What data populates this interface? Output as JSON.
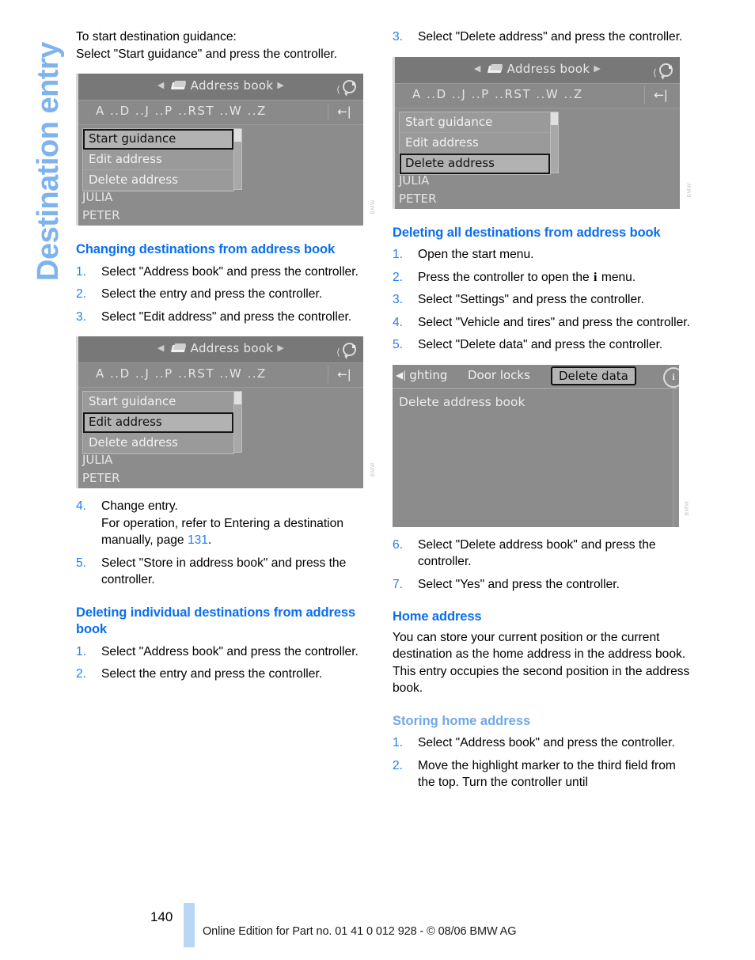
{
  "chapter_tab": "Destination entry",
  "left_column": {
    "intro": {
      "line1": "To start destination guidance:",
      "line2": "Select \"Start guidance\" and press the controller."
    },
    "figure1": {
      "title": "Address book",
      "icon": "address-book-icon",
      "alpha_bar": "A ..D ..J ..P ..RST ..W ..Z",
      "back_icon": "back-arrow-icon",
      "compass_icon": "compass-icon",
      "menu_items": [
        "Start guidance",
        "Edit address",
        "Delete address"
      ],
      "selected_item": "Start guidance",
      "entries": [
        "JULIA",
        "PETER"
      ]
    },
    "section1": {
      "heading": "Changing destinations from address book",
      "steps": [
        {
          "num": "1.",
          "text": "Select \"Address book\" and press the controller."
        },
        {
          "num": "2.",
          "text": "Select the entry and press the controller."
        },
        {
          "num": "3.",
          "text": "Select \"Edit address\" and press the controller."
        }
      ]
    },
    "figure2": {
      "title": "Address book",
      "icon": "address-book-icon",
      "alpha_bar": "A ..D ..J ..P ..RST ..W ..Z",
      "back_icon": "back-arrow-icon",
      "compass_icon": "compass-icon",
      "menu_items": [
        "Start guidance",
        "Edit address",
        "Delete address"
      ],
      "selected_item": "Edit address",
      "entries": [
        "JULIA",
        "PETER"
      ]
    },
    "steps_after_fig2": [
      {
        "num": "4.",
        "text_a": "Change entry.",
        "text_b": "For operation, refer to Entering a destination manually, page ",
        "pageref": "131",
        "text_c": "."
      },
      {
        "num": "5.",
        "text": "Select \"Store in address book\" and press the controller."
      }
    ],
    "section2": {
      "heading": "Deleting individual destinations from address book",
      "steps": [
        {
          "num": "1.",
          "text": "Select \"Address book\" and press the controller."
        },
        {
          "num": "2.",
          "text": "Select the entry and press the controller."
        }
      ]
    }
  },
  "right_column": {
    "step3": {
      "num": "3.",
      "text": "Select \"Delete address\" and press the controller."
    },
    "figure3": {
      "title": "Address book",
      "icon": "address-book-icon",
      "alpha_bar": "A ..D ..J ..P ..RST ..W ..Z",
      "back_icon": "back-arrow-icon",
      "compass_icon": "compass-icon",
      "menu_items": [
        "Start guidance",
        "Edit address",
        "Delete address"
      ],
      "selected_item": "Delete address",
      "entries": [
        "JULIA",
        "PETER"
      ]
    },
    "section3": {
      "heading": "Deleting all destinations from address book",
      "steps": [
        {
          "num": "1.",
          "text": "Open the start menu."
        },
        {
          "num": "2.",
          "text_a": "Press the controller to open the ",
          "iglyph": "i",
          "text_b": " menu."
        },
        {
          "num": "3.",
          "text": "Select \"Settings\" and press the controller."
        },
        {
          "num": "4.",
          "text": "Select \"Vehicle and tires\" and press the controller."
        },
        {
          "num": "5.",
          "text": "Select \"Delete data\" and press the controller."
        }
      ]
    },
    "figure4": {
      "tab_left": "ghting",
      "tab_left_icon": "scroll-left-icon",
      "tab_middle": "Door locks",
      "tab_selected": "Delete data",
      "info_icon": "info-icon",
      "list_item": "Delete address book"
    },
    "steps_after_fig4": [
      {
        "num": "6.",
        "text": "Select \"Delete address book\" and press the controller."
      },
      {
        "num": "7.",
        "text": "Select \"Yes\" and press the controller."
      }
    ],
    "section4": {
      "heading": "Home address",
      "paragraph": "You can store your current position or the current destination as the home address in the address book. This entry occupies the second position in the address book."
    },
    "section5": {
      "subheading": "Storing home address",
      "steps": [
        {
          "num": "1.",
          "text": "Select \"Address book\" and press the controller."
        },
        {
          "num": "2.",
          "text": "Move the highlight marker to the third field from the top. Turn the controller until"
        }
      ]
    }
  },
  "footer": {
    "page_number": "140",
    "text": "Online Edition for Part no. 01 41 0 012 928 - © 08/06 BMW AG"
  },
  "colors": {
    "heading_blue": "#0a6ef0",
    "subheading_blue": "#6fa8e8",
    "tab_blue": "#7fb3ee",
    "footer_bar": "#b9d6f5"
  }
}
